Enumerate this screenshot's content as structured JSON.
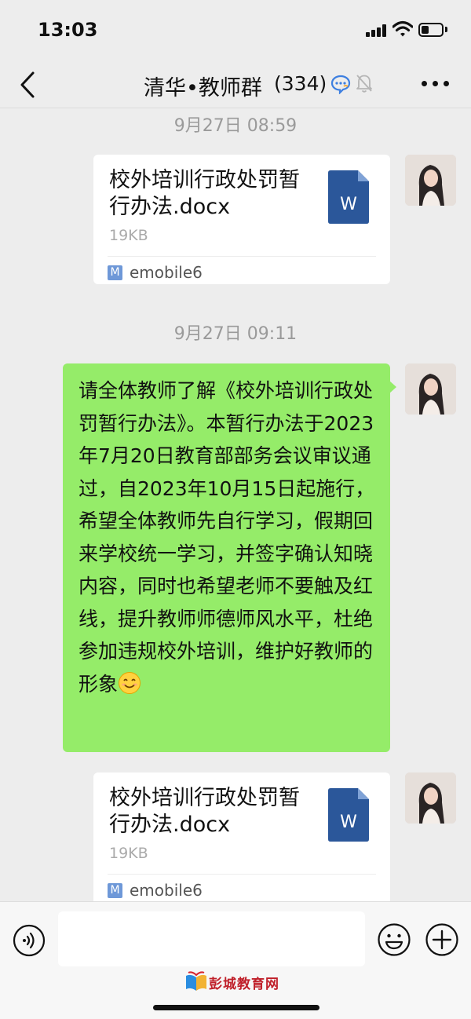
{
  "status_bar": {
    "time": "13:03",
    "battery_level": 0.3
  },
  "nav": {
    "title": "清华•教师群",
    "member_count": "(334)",
    "icons": [
      "back-icon",
      "chat-badge-icon",
      "mute-icon",
      "more-icon"
    ]
  },
  "messages": [
    {
      "type": "timestamp",
      "text": "9月27日 08:59"
    },
    {
      "type": "file",
      "file_name": "校外培训行政处罚暂行办法.docx",
      "file_size": "19KB",
      "source": "emobile6",
      "file_icon_letter": "W"
    },
    {
      "type": "timestamp",
      "text": "9月27日 09:11"
    },
    {
      "type": "text",
      "text": "请全体教师了解《校外培训行政处罚暂行办法》。本暂行办法于2023年7月20日教育部部务会议审议通过，自2023年10月15日起施行，希望全体教师先自行学习，假期回来学校统一学习，并签字确认知晓内容，同时也希望老师不要触及红线，提升教师师德师风水平，杜绝参加违规校外培训，维护好教师的形象",
      "emoji": "smile"
    },
    {
      "type": "file",
      "file_name": "校外培训行政处罚暂行办法.docx",
      "file_size": "19KB",
      "source": "emobile6",
      "file_icon_letter": "W"
    }
  ],
  "input_bar": {
    "placeholder": "",
    "icons": [
      "voice-icon",
      "emoji-icon",
      "plus-icon"
    ]
  },
  "watermark": {
    "text": "彭城教育网"
  },
  "colors": {
    "background": "#ededed",
    "bubble_green": "#95ec69",
    "word_blue": "#2b579a",
    "watermark_red": "#c0202a"
  }
}
